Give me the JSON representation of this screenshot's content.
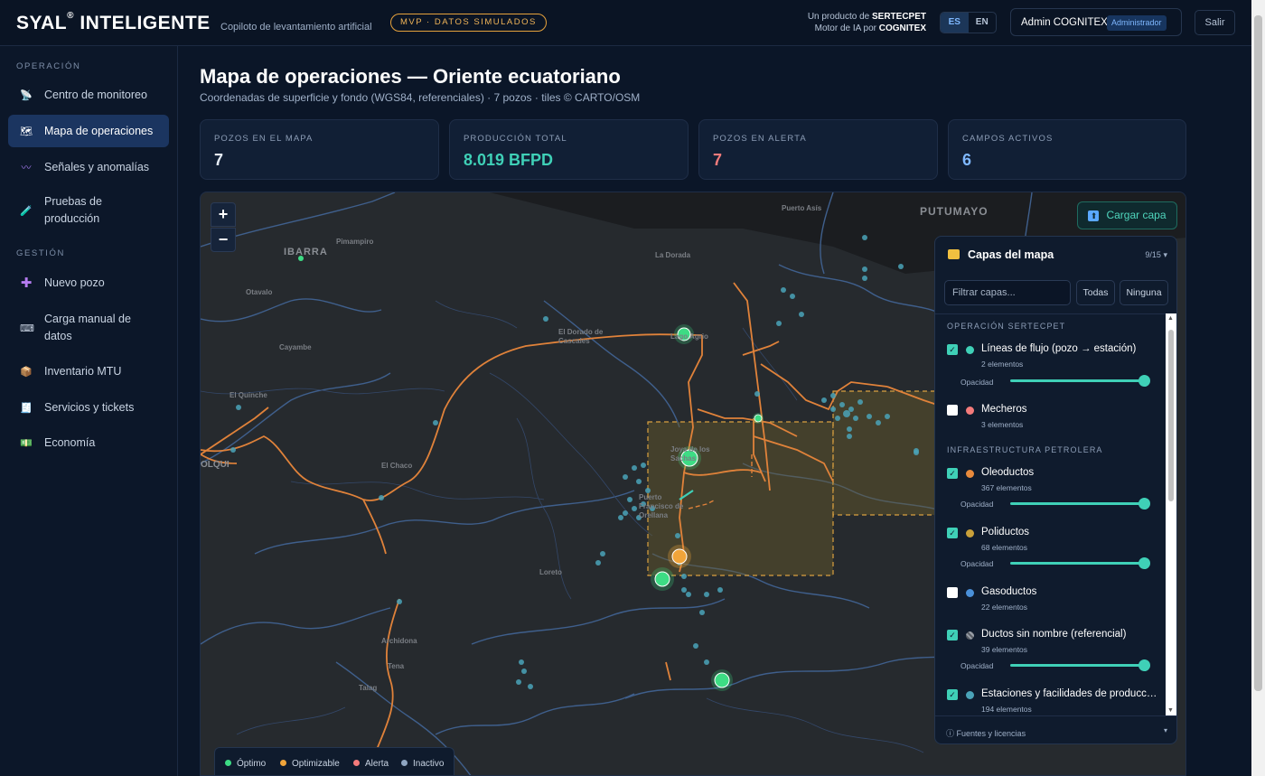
{
  "header": {
    "brand": "SYAL",
    "brand_mark": "®",
    "brand_suffix": "INTELIGENTE",
    "tagline": "Copiloto de levantamiento artificial",
    "badge": "MVP · DATOS SIMULADOS",
    "product_prefix": "Un producto de",
    "product_company": "SERTECPET",
    "engine_prefix": "Motor de IA por",
    "engine_company": "COGNITEX",
    "lang_es": "ES",
    "lang_en": "EN",
    "user_name": "Admin COGNITEX",
    "user_role": "Administrador",
    "logout": "Salir"
  },
  "sidebar": {
    "section_operacion": "OPERACIÓN",
    "section_gestion": "GESTIÓN",
    "items": [
      {
        "label": "Centro de monitoreo",
        "icon": "antenna-icon"
      },
      {
        "label": "Mapa de operaciones",
        "icon": "map-icon",
        "active": true
      },
      {
        "label": "Señales y anomalías",
        "icon": "wave-icon"
      },
      {
        "label": "Pruebas de producción",
        "icon": "test-tube-icon"
      },
      {
        "label": "Nuevo pozo",
        "icon": "plus-icon"
      },
      {
        "label": "Carga manual de datos",
        "icon": "keyboard-icon"
      },
      {
        "label": "Inventario MTU",
        "icon": "box-icon"
      },
      {
        "label": "Servicios y tickets",
        "icon": "receipt-icon"
      },
      {
        "label": "Economía",
        "icon": "money-icon"
      }
    ]
  },
  "main": {
    "title": "Mapa de operaciones — Oriente ecuatoriano",
    "subtitle": "Coordenadas de superficie y fondo (WGS84, referenciales) · 7 pozos · tiles © CARTO/OSM",
    "stats": [
      {
        "label": "POZOS EN EL MAPA",
        "value": "7",
        "color": "#e6edf7"
      },
      {
        "label": "PRODUCCIÓN TOTAL",
        "value": "8.019 BFPD",
        "color": "#3fd0b7"
      },
      {
        "label": "POZOS EN ALERTA",
        "value": "7",
        "color": "#f47b7b"
      },
      {
        "label": "CAMPOS ACTIVOS",
        "value": "6",
        "color": "#7fb8ff"
      }
    ]
  },
  "map": {
    "zoom_in": "+",
    "zoom_out": "−",
    "upload_label": "Cargar capa",
    "place_labels": [
      "PUTUMAYO",
      "Puerto Asís",
      "La Dorada",
      "IBARRA",
      "Pimampiro",
      "Otavalo",
      "Cayambe",
      "El Quinche",
      "El Dorado de Cascales",
      "Lago Agrio",
      "El Chaco",
      "Joya de los Sachas",
      "Puerto Francisco de Orellana",
      "Loreto",
      "Archidona",
      "Tena",
      "Talag",
      "OLQUI"
    ]
  },
  "layers_panel": {
    "title": "Capas del mapa",
    "count": "9/15",
    "filter_placeholder": "Filtrar capas...",
    "btn_all": "Todas",
    "btn_none": "Ninguna",
    "group_1": "OPERACIÓN SERTECPET",
    "group_2": "INFRAESTRUCTURA PETROLERA",
    "opacity_label": "Opacidad",
    "layers": [
      {
        "name": "Líneas de flujo (pozo → estación)",
        "count": "2 elementos",
        "checked": true,
        "color": "#3fd0b7"
      },
      {
        "name": "Mecheros",
        "count": "3 elementos",
        "checked": false,
        "color": "#f47b7b"
      },
      {
        "name": "Oleoductos",
        "count": "367 elementos",
        "checked": true,
        "color": "#e88a3c"
      },
      {
        "name": "Poliductos",
        "count": "68 elementos",
        "checked": true,
        "color": "#c9a03a"
      },
      {
        "name": "Gasoductos",
        "count": "22 elementos",
        "checked": false,
        "color": "#4a90d9"
      },
      {
        "name": "Ductos sin nombre (referencial)",
        "count": "39 elementos",
        "checked": true,
        "color": "#9aa0a8"
      },
      {
        "name": "Estaciones y facilidades de producción",
        "count": "194 elementos",
        "checked": true,
        "color": "#4aa3b8"
      }
    ],
    "footer": "Fuentes y licencias"
  },
  "legend": [
    {
      "label": "Óptimo",
      "color": "#3ddc84"
    },
    {
      "label": "Optimizable",
      "color": "#f0a43a"
    },
    {
      "label": "Alerta",
      "color": "#f47b7b"
    },
    {
      "label": "Inactivo",
      "color": "#8fa6c2"
    }
  ]
}
